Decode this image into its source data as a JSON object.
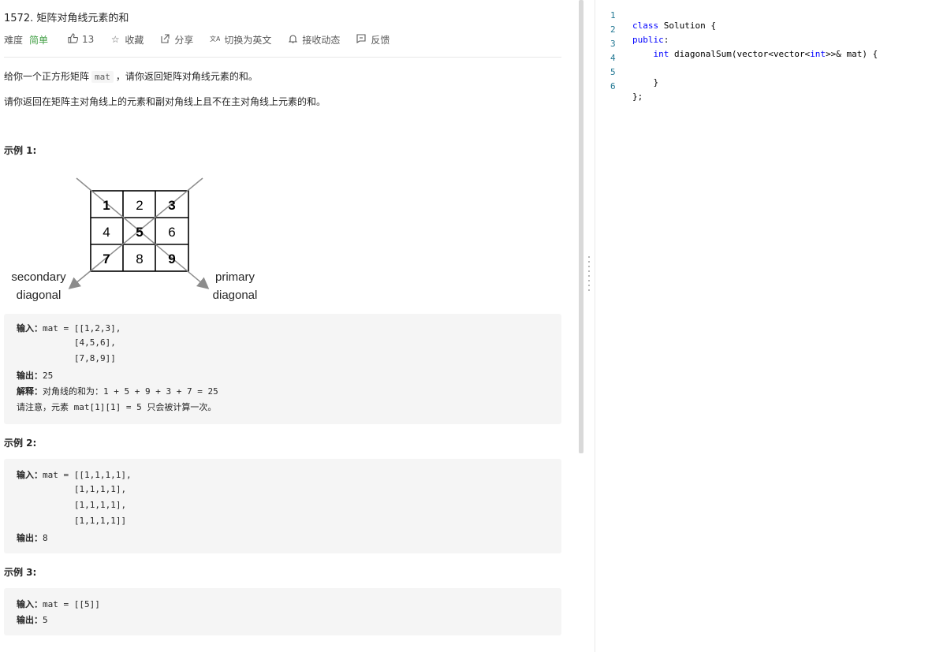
{
  "problem": {
    "title": "1572. 矩阵对角线元素的和",
    "difficulty_label": "难度",
    "difficulty": "简单",
    "likes": "13",
    "actions": {
      "favorite": "收藏",
      "share": "分享",
      "switch_lang": "切换为英文",
      "notifications": "接收动态",
      "feedback": "反馈"
    },
    "desc1_pre": "给你一个正方形矩阵",
    "desc1_code": "mat",
    "desc1_post": "，请你返回矩阵对角线元素的和。",
    "desc2": "请你返回在矩阵主对角线上的元素和副对角线上且不在主对角线上元素的和。"
  },
  "figure": {
    "cells": [
      "1",
      "2",
      "3",
      "4",
      "5",
      "6",
      "7",
      "8",
      "9"
    ],
    "secondary_label_1": "secondary",
    "secondary_label_2": "diagonal",
    "primary_label_1": "primary",
    "primary_label_2": "diagonal"
  },
  "examples": [
    {
      "title": "示例 1:",
      "lines": [
        {
          "label": "输入：",
          "text": "mat = [[1,2,3],"
        },
        {
          "label": "",
          "text": "           [4,5,6],"
        },
        {
          "label": "",
          "text": "           [7,8,9]]"
        },
        {
          "label": "输出：",
          "text": "25"
        },
        {
          "label": "解释：",
          "text": "对角线的和为：1 + 5 + 9 + 3 + 7 = 25"
        },
        {
          "label": "",
          "text": "请注意，元素 mat[1][1] = 5 只会被计算一次。"
        }
      ]
    },
    {
      "title": "示例 2:",
      "lines": [
        {
          "label": "输入：",
          "text": "mat = [[1,1,1,1],"
        },
        {
          "label": "",
          "text": "           [1,1,1,1],"
        },
        {
          "label": "",
          "text": "           [1,1,1,1],"
        },
        {
          "label": "",
          "text": "           [1,1,1,1]]"
        },
        {
          "label": "输出：",
          "text": "8"
        }
      ]
    },
    {
      "title": "示例 3:",
      "lines": [
        {
          "label": "输入：",
          "text": "mat = [[5]]"
        },
        {
          "label": "输出：",
          "text": "5"
        }
      ]
    }
  ],
  "editor": {
    "lines": [
      {
        "n": "1",
        "kw": "class",
        "rest": " Solution {"
      },
      {
        "n": "2",
        "kw": "public",
        "rest": ":"
      },
      {
        "n": "3",
        "indent": "    ",
        "kw": "int",
        "rest": " diagonalSum(vector<vector<",
        "kw2": "int",
        "rest2": ">>& mat) {"
      },
      {
        "n": "4",
        "rest": ""
      },
      {
        "n": "5",
        "rest": "    }"
      },
      {
        "n": "6",
        "rest": "};"
      }
    ]
  }
}
